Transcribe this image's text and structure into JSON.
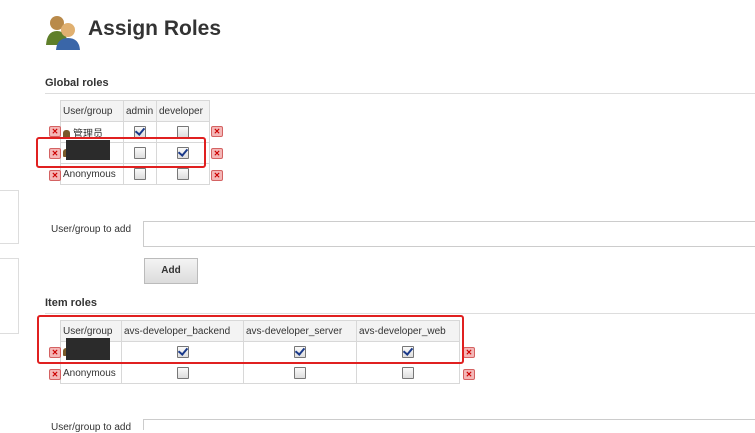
{
  "page": {
    "title": "Assign Roles",
    "logo_icon": "users-icon"
  },
  "global_roles": {
    "heading": "Global roles",
    "headers": [
      "User/group",
      "admin",
      "developer"
    ],
    "rows": [
      {
        "name": "管理员",
        "values": [
          true,
          false
        ]
      },
      {
        "name": "",
        "values": [
          false,
          true
        ]
      },
      {
        "name": "Anonymous",
        "values": [
          false,
          false
        ]
      }
    ],
    "add_label": "User/group to add",
    "add_button": "Add"
  },
  "item_roles": {
    "heading": "Item roles",
    "headers": [
      "User/group",
      "avs-developer_backend",
      "avs-developer_server",
      "avs-developer_web"
    ],
    "rows": [
      {
        "name": "",
        "values": [
          true,
          true,
          true
        ]
      },
      {
        "name": "Anonymous",
        "values": [
          false,
          false,
          false
        ]
      }
    ],
    "add_label": "User/group to add"
  },
  "colors": {
    "highlight": "#e02020",
    "delete": "#d46262"
  }
}
